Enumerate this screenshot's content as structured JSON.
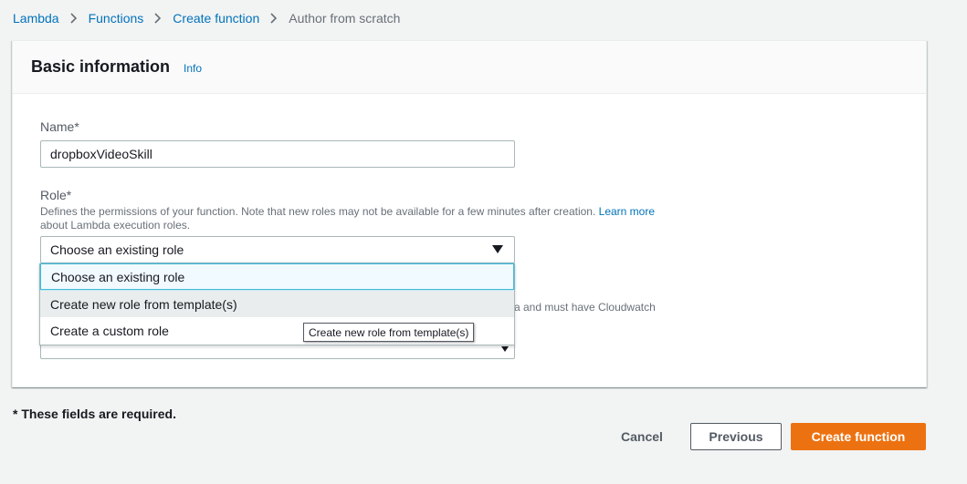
{
  "breadcrumb": {
    "items": [
      "Lambda",
      "Functions",
      "Create function"
    ],
    "current": "Author from scratch"
  },
  "card": {
    "title": "Basic information",
    "info": "Info"
  },
  "name_field": {
    "label": "Name*",
    "value": "dropboxVideoSkill"
  },
  "role_field": {
    "label": "Role*",
    "description": "Defines the permissions of your function. Note that new roles may not be available for a few minutes after creation.",
    "learn_more": "Learn more",
    "description_cont": "about Lambda execution roles.",
    "selected": "Choose an existing role",
    "options": [
      "Choose an existing role",
      "Create new role from template(s)",
      "Create a custom role"
    ]
  },
  "obscured": {
    "desc_fragment": "a and must have Cloudwatch"
  },
  "tooltip": "Create new role from template(s)",
  "required_note": "* These fields are required.",
  "buttons": {
    "cancel": "Cancel",
    "previous": "Previous",
    "create": "Create function"
  },
  "colors": {
    "link": "#0073bb",
    "primary": "#ec7211",
    "focus": "#44b9d6"
  }
}
